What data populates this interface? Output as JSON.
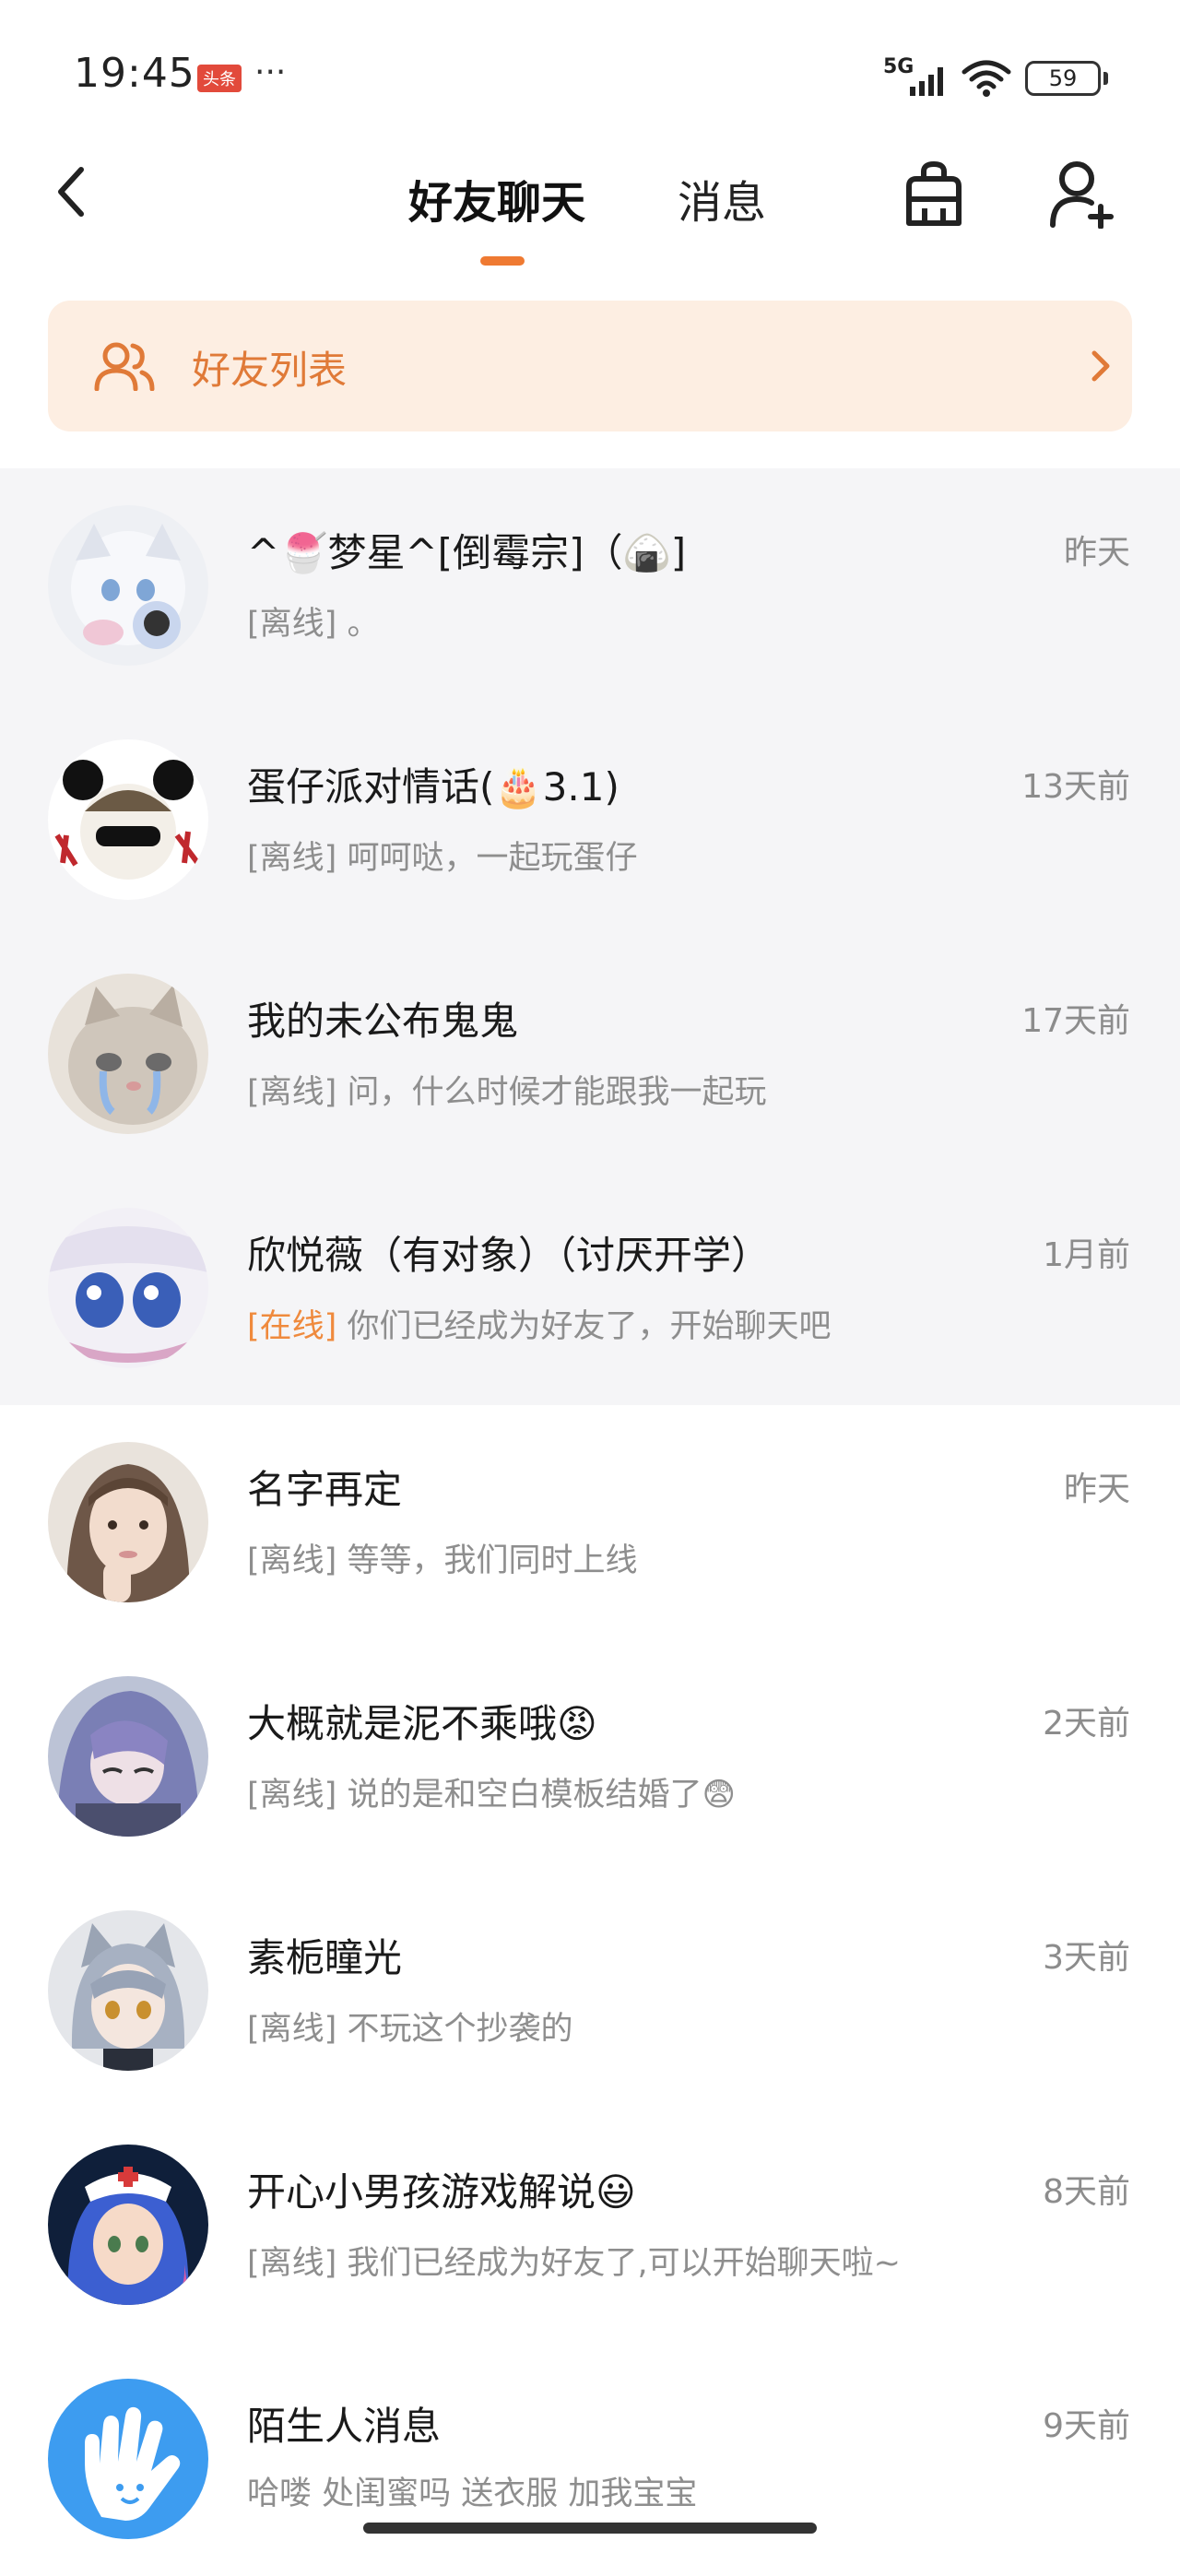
{
  "status_bar": {
    "time": "19:45",
    "news_badge": "头条",
    "dots": "···",
    "network": "5G",
    "battery": "59"
  },
  "header": {
    "tab_friends": "好友聊天",
    "tab_messages": "消息",
    "active_tab_color": "#ef7a32"
  },
  "banner": {
    "label": "好友列表",
    "background": "#fdeee2",
    "accent": "#e07a38"
  },
  "chats": [
    {
      "name": "^🍧梦星^[倒霉宗]（🍙]",
      "time": "昨天",
      "status": "[离线]",
      "online": false,
      "message": " 。",
      "avatar": "anime-girl-avatar"
    },
    {
      "name": "蛋仔派对情话(🎂3.1)",
      "time": "13天前",
      "status": "[离线]",
      "online": false,
      "message": " 呵呵哒，一起玩蛋仔",
      "avatar": "panda-hat-avatar"
    },
    {
      "name": "我的未公布鬼鬼",
      "time": "17天前",
      "status": "[离线]",
      "online": false,
      "message": " 问，什么时候才能跟我一起玩",
      "avatar": "crying-cat-avatar"
    },
    {
      "name": "欣悦薇（有对象）（讨厌开学）",
      "time": "1月前",
      "status": "[在线]",
      "online": true,
      "message": " 你们已经成为好友了，开始聊天吧",
      "avatar": "anime-eyes-avatar"
    },
    {
      "name": "名字再定",
      "time": "昨天",
      "status": "[离线]",
      "online": false,
      "message": " 等等，我们同时上线",
      "avatar": "girl-photo-avatar"
    },
    {
      "name": "大概就是泥不乘哦😡",
      "time": "2天前",
      "status": "[离线]",
      "online": false,
      "message": " 说的是和空白模板结婚了😨",
      "avatar": "anime-purple-avatar"
    },
    {
      "name": "素栀瞳光",
      "time": "3天前",
      "status": "[离线]",
      "online": false,
      "message": " 不玩这个抄袭的",
      "avatar": "cat-ear-girl-avatar"
    },
    {
      "name": "开心小男孩游戏解说😃",
      "time": "8天前",
      "status": "[离线]",
      "online": false,
      "message": " 我们已经成为好友了,可以开始聊天啦~",
      "avatar": "nurse-girl-avatar"
    },
    {
      "name": "陌生人消息",
      "time": "9天前",
      "status": "",
      "online": false,
      "message": "哈喽 处闺蜜吗 送衣服 加我宝宝",
      "avatar": "hand-icon-avatar"
    }
  ]
}
